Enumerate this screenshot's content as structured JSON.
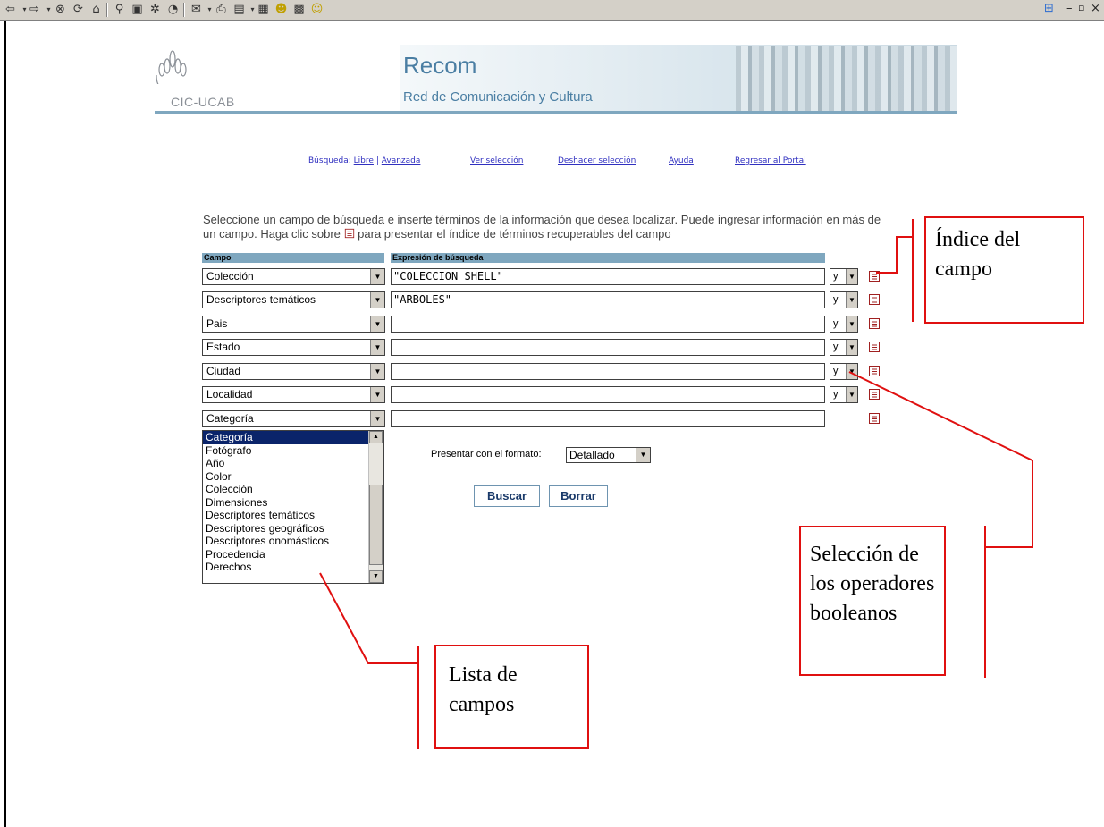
{
  "browser": {
    "toolbar_icons": [
      "back-arrow-icon",
      "forward-arrow-icon",
      "stop-icon",
      "refresh-icon",
      "home-icon",
      "search-icon",
      "favorites-icon",
      "history-icon",
      "media-icon",
      "mail-icon",
      "print-icon",
      "edit-icon",
      "discuss-icon",
      "messenger-icon",
      "extra-icon",
      "smiley-icon"
    ],
    "window_controls": [
      "windows-logo",
      "minimize",
      "restore",
      "close"
    ]
  },
  "header": {
    "logo_text": "CIC-UCAB",
    "title": "Recom",
    "subtitle": "Red de Comunicación y Cultura"
  },
  "nav": {
    "search_label": "Búsqueda:",
    "libre": "Libre",
    "separator": "|",
    "avanzada": "Avanzada",
    "ver_seleccion": "Ver selección",
    "deshacer_seleccion": "Deshacer selección",
    "ayuda": "Ayuda",
    "regresar": "Regresar al Portal"
  },
  "instructions": {
    "line_before_icon": "Seleccione un campo de búsqueda e inserte términos de la información que desea localizar. Puede ingresar información en más de un campo. Haga clic sobre",
    "line_after_icon": "para presentar el índice de términos recuperables del campo"
  },
  "table_headers": {
    "campo": "Campo",
    "expresion": "Expresión de búsqueda"
  },
  "rows": [
    {
      "campo": "Colección",
      "expresion": "\"COLECCION SHELL\"",
      "operator": "y"
    },
    {
      "campo": "Descriptores temáticos",
      "expresion": "\"ARBOLES\"",
      "operator": "y"
    },
    {
      "campo": "Pais",
      "expresion": "",
      "operator": "y"
    },
    {
      "campo": "Estado",
      "expresion": "",
      "operator": "y"
    },
    {
      "campo": "Ciudad",
      "expresion": "",
      "operator": "y"
    },
    {
      "campo": "Localidad",
      "expresion": "",
      "operator": "y"
    },
    {
      "campo": "Categoría",
      "expresion": "",
      "operator": ""
    }
  ],
  "field_list": {
    "selected": "Categoría",
    "options": [
      "Categoría",
      "Fotógrafo",
      "Año",
      "Color",
      "Colección",
      "Dimensiones",
      "Descriptores temáticos",
      "Descriptores geográficos",
      "Descriptores onomásticos",
      "Procedencia",
      "Derechos"
    ]
  },
  "format": {
    "label": "Presentar con el formato:",
    "value": "Detallado"
  },
  "buttons": {
    "buscar": "Buscar",
    "borrar": "Borrar"
  },
  "annotations": {
    "indice": "Índice del campo",
    "operadores": "Selección de los operadores booleanos",
    "lista": "Lista de campos",
    "color": "#e01010"
  }
}
